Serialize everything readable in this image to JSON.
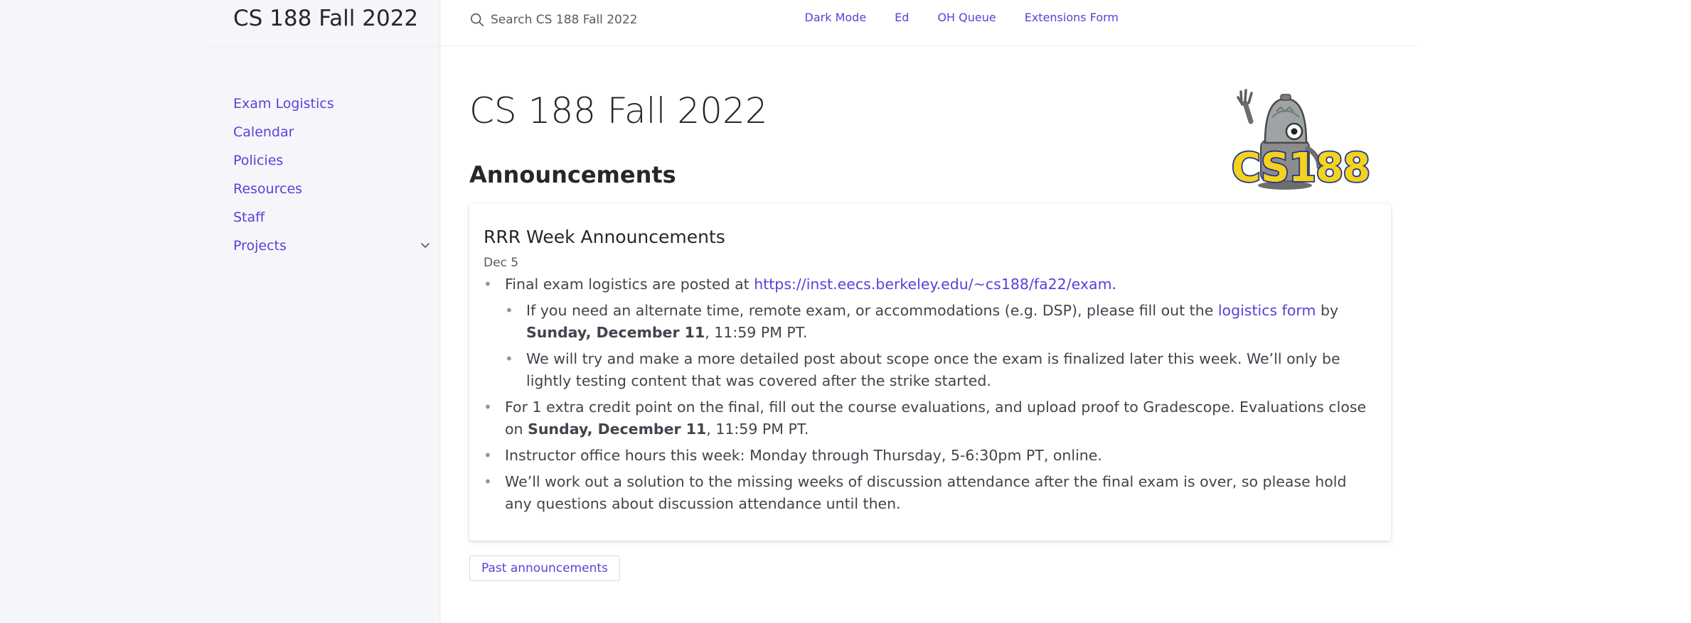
{
  "site": {
    "title": "CS 188 Fall 2022"
  },
  "nav": {
    "items": [
      {
        "label": "Exam Logistics"
      },
      {
        "label": "Calendar"
      },
      {
        "label": "Policies"
      },
      {
        "label": "Resources"
      },
      {
        "label": "Staff"
      },
      {
        "label": "Projects",
        "expandable": true,
        "icon": "chevron-down-icon"
      }
    ]
  },
  "search": {
    "placeholder": "Search CS 188 Fall 2022",
    "value": "",
    "icon": "search-icon"
  },
  "aux_links": [
    {
      "label": "Dark Mode"
    },
    {
      "label": "Ed"
    },
    {
      "label": "OH Queue"
    },
    {
      "label": "Extensions Form"
    }
  ],
  "page": {
    "title": "CS 188 Fall 2022",
    "section": "Announcements",
    "logo": {
      "text": "CS188",
      "icon": "pacman-robot-logo"
    }
  },
  "announcement": {
    "title": "RRR Week Announcements",
    "date": "Dec 5",
    "item1": {
      "pre": "Final exam logistics are posted at ",
      "link": "https://inst.eecs.berkeley.edu/~cs188/fa22/exam",
      "post": ".",
      "sub1": {
        "pre": "If you need an alternate time, remote exam, or accommodations (e.g. DSP), please fill out the ",
        "link": "logistics form",
        "mid": " by ",
        "bold": "Sunday, December 11",
        "post": ", 11:59 PM PT."
      },
      "sub2": "We will try and make a more detailed post about scope once the exam is finalized later this week. We’ll only be lightly testing content that was covered after the strike started."
    },
    "item2": {
      "pre": "For 1 extra credit point on the final, fill out the course evaluations, and upload proof to Gradescope. Evaluations close on ",
      "bold": "Sunday, December 11",
      "post": ", 11:59 PM PT."
    },
    "item3": "Instructor office hours this week: Monday through Thursday, 5-6:30pm PT, online.",
    "item4": "We’ll work out a solution to the missing weeks of discussion attendance after the final exam is over, so please hold any questions about discussion attendance until then."
  },
  "buttons": {
    "past": "Past announcements"
  },
  "colors": {
    "link": "#5c3fd8",
    "text": "#27262b",
    "sidebar_bg": "#f5f6fa",
    "logo_yellow": "#f5d21d",
    "logo_blue": "#22348c"
  }
}
